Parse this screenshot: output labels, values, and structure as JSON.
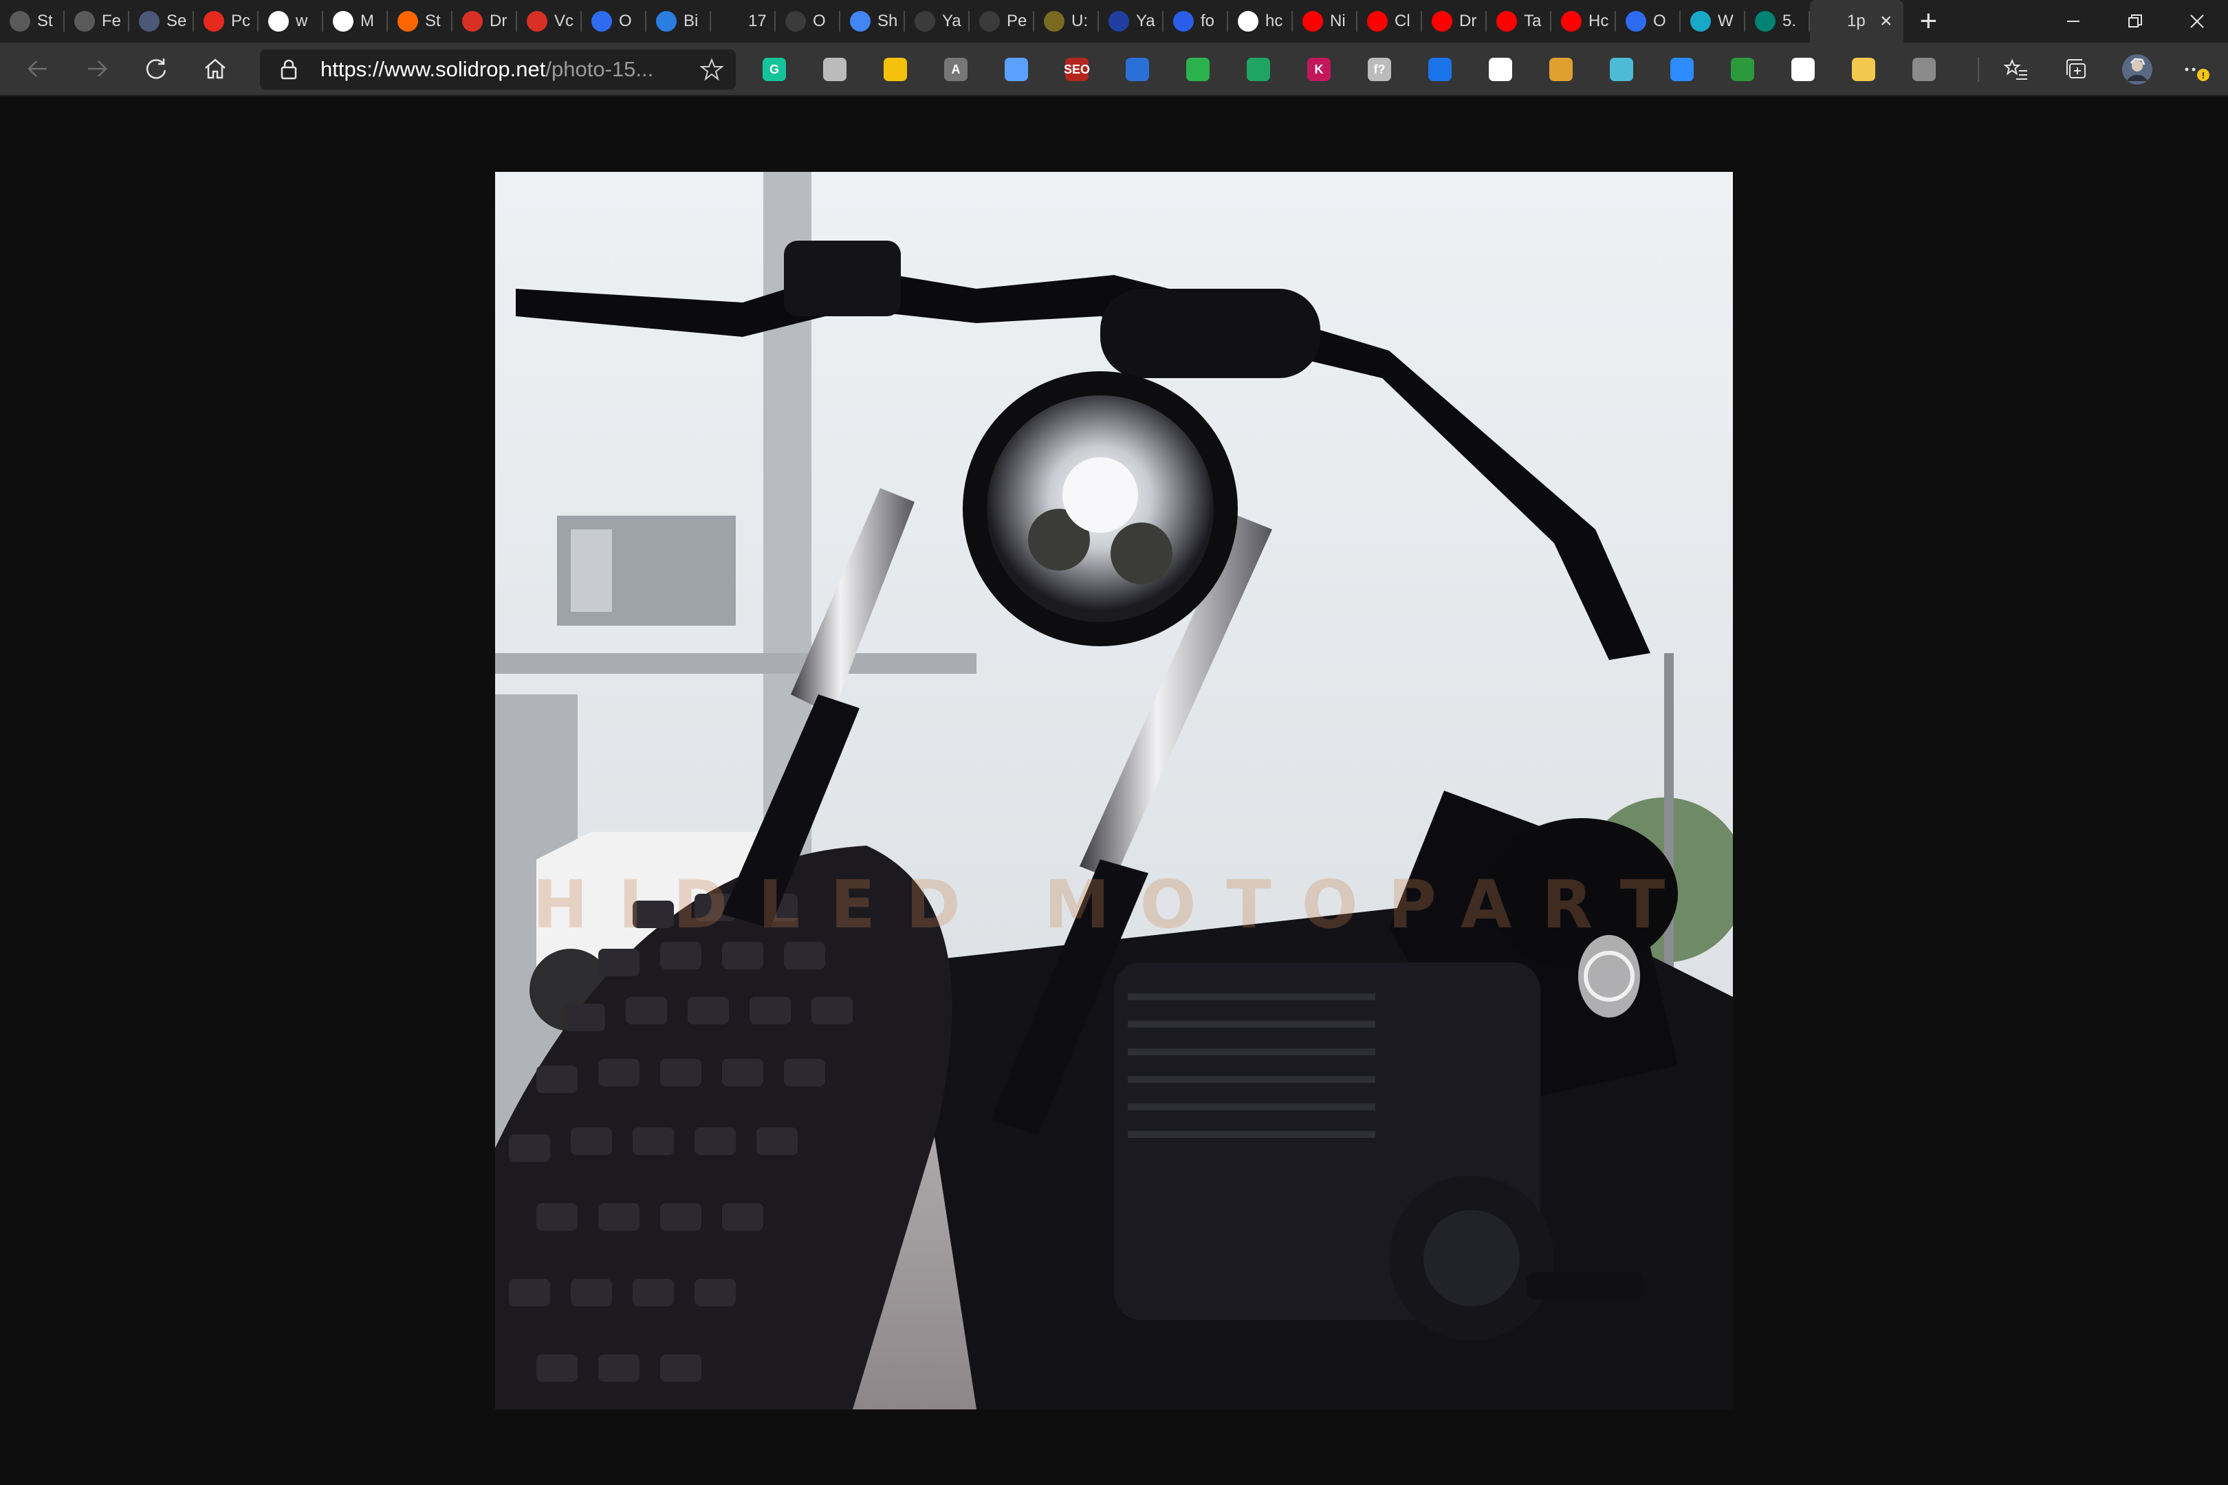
{
  "tabs": [
    {
      "label": "St",
      "icon": "circle-outline-icon",
      "color": "#5a5a5a"
    },
    {
      "label": "Fe",
      "icon": "circle-outline-icon",
      "color": "#5a5a5a"
    },
    {
      "label": "Se",
      "icon": "shield-icon",
      "color": "#4b5878"
    },
    {
      "label": "Pc",
      "icon": "ted-icon",
      "color": "#e62b1e"
    },
    {
      "label": "w",
      "icon": "document-icon",
      "color": "#ffffff"
    },
    {
      "label": "M",
      "icon": "document-icon",
      "color": "#ffffff"
    },
    {
      "label": "St",
      "icon": "y-combinator-icon",
      "color": "#ff6600"
    },
    {
      "label": "Dr",
      "icon": "gmail-icon",
      "color": "#d93025"
    },
    {
      "label": "Vc",
      "icon": "gmail-icon",
      "color": "#d93025"
    },
    {
      "label": "O",
      "icon": "docs-icon",
      "color": "#2e6bf0"
    },
    {
      "label": "Bi",
      "icon": "z-icon",
      "color": "#2a7de1"
    },
    {
      "label": "17",
      "icon": "blank-icon",
      "color": "#202020"
    },
    {
      "label": "O",
      "icon": "circle-info-icon",
      "color": "#3b3b3b"
    },
    {
      "label": "Sh",
      "icon": "docs-icon",
      "color": "#4285f4"
    },
    {
      "label": "Ya",
      "icon": "globe-icon",
      "color": "#3b3b3b"
    },
    {
      "label": "Pe",
      "icon": "globe-icon",
      "color": "#3b3b3b"
    },
    {
      "label": "U:",
      "icon": "gear-icon",
      "color": "#7a6a20"
    },
    {
      "label": "Ya",
      "icon": "news-icon",
      "color": "#1f3fa0"
    },
    {
      "label": "fo",
      "icon": "play-icon",
      "color": "#2a5ee8"
    },
    {
      "label": "hc",
      "icon": "google-icon",
      "color": "#ffffff"
    },
    {
      "label": "Ni",
      "icon": "youtube-icon",
      "color": "#ff0000"
    },
    {
      "label": "Cl",
      "icon": "youtube-icon",
      "color": "#ff0000"
    },
    {
      "label": "Dr",
      "icon": "youtube-icon",
      "color": "#ff0000"
    },
    {
      "label": "Ta",
      "icon": "youtube-icon",
      "color": "#ff0000"
    },
    {
      "label": "Hc",
      "icon": "youtube-icon",
      "color": "#ff0000"
    },
    {
      "label": "O",
      "icon": "docs-icon",
      "color": "#2e6bf0"
    },
    {
      "label": "W",
      "icon": "feather-icon",
      "color": "#18a8c8"
    },
    {
      "label": "5.",
      "icon": "bing-icon",
      "color": "#008373"
    },
    {
      "label": "1p",
      "icon": "blank-icon",
      "color": "#353535",
      "active": true
    }
  ],
  "new_tab_symbol": "+",
  "toolbar": {
    "url_host": "https://www.solidrop.net",
    "url_path": "/photo-15..."
  },
  "extensions": [
    {
      "name": "grammarly-icon",
      "text": "G",
      "color": "#15c39a"
    },
    {
      "name": "circle-half-icon",
      "text": "",
      "color": "#bbbbbb"
    },
    {
      "name": "sticky-note-icon",
      "text": "",
      "color": "#f4c20d"
    },
    {
      "name": "translate-icon",
      "text": "A",
      "color": "#777777"
    },
    {
      "name": "pen-icon",
      "text": "",
      "color": "#5aa0ff"
    },
    {
      "name": "seo-icon",
      "text": "SEO",
      "color": "#b3261e"
    },
    {
      "name": "rss-icon",
      "text": "",
      "color": "#2a6fd6"
    },
    {
      "name": "feedly-icon",
      "text": "",
      "color": "#2bb24c"
    },
    {
      "name": "google-drive-icon",
      "text": "",
      "color": "#1fa463"
    },
    {
      "name": "k-icon",
      "text": "K",
      "color": "#c2185b"
    },
    {
      "name": "function-icon",
      "text": "f?",
      "color": "#bbbbbb"
    },
    {
      "name": "checkmark-icon",
      "text": "",
      "color": "#1a73e8"
    },
    {
      "name": "cloud-icon",
      "text": "",
      "color": "#ffffff"
    },
    {
      "name": "owl-icon",
      "text": "",
      "color": "#e0a030"
    },
    {
      "name": "react-icon",
      "text": "",
      "color": "#4dbbd5"
    },
    {
      "name": "zoom-icon",
      "text": "",
      "color": "#2d8cff"
    },
    {
      "name": "screenshot-icon",
      "text": "",
      "color": "#2b9a3b"
    },
    {
      "name": "cloud-white-icon",
      "text": "",
      "color": "#ffffff"
    },
    {
      "name": "color-wheel-icon",
      "text": "",
      "color": "#f2c94c"
    },
    {
      "name": "extension-badge-icon",
      "text": "",
      "color": "#8a8a8a"
    }
  ],
  "photo": {
    "description_alt": "Black custom motorcycle front view with LED headlight",
    "watermark": "HIDLED MOTOPART"
  }
}
